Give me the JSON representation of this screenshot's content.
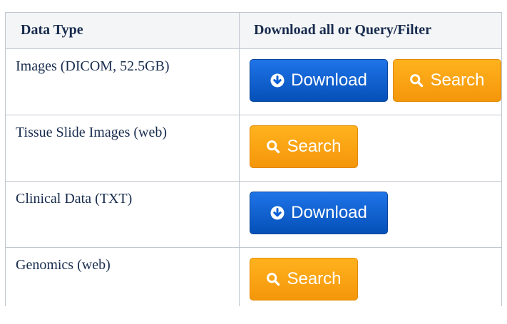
{
  "table": {
    "headers": {
      "type": "Data Type",
      "actions": "Download all or Query/Filter"
    },
    "rows": [
      {
        "label": "Images (DICOM, 52.5GB)",
        "download_label": "Download",
        "search_label": "Search"
      },
      {
        "label": "Tissue Slide Images (web)",
        "search_label": "Search"
      },
      {
        "label": "Clinical Data (TXT)",
        "download_label": "Download"
      },
      {
        "label": "Genomics (web)",
        "search_label": "Search"
      }
    ]
  },
  "colors": {
    "download_button": "#0a5fd6",
    "search_button": "#fca311",
    "header_bg": "#f4f5f7",
    "border": "#c1c7d0",
    "text": "#172b4d"
  },
  "icons": {
    "download": "arrow-down-circle-icon",
    "search": "magnifier-icon"
  }
}
